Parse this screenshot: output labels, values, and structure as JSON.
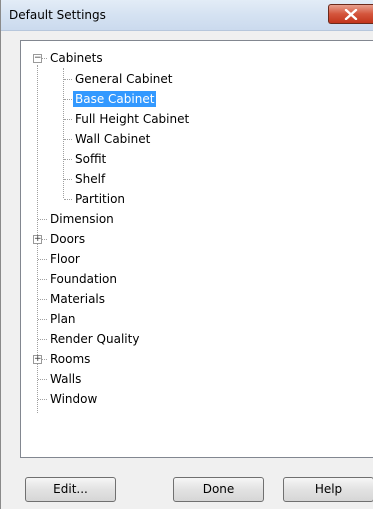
{
  "window": {
    "title": "Default Settings"
  },
  "tree": {
    "cabinets": {
      "label": "Cabinets",
      "expanded": true,
      "children": [
        "General Cabinet",
        "Base Cabinet",
        "Full Height Cabinet",
        "Wall Cabinet",
        "Soffit",
        "Shelf",
        "Partition"
      ],
      "selected": "Base Cabinet"
    },
    "dimension": "Dimension",
    "doors": {
      "label": "Doors",
      "expanded": false
    },
    "floor": "Floor",
    "foundation": "Foundation",
    "materials": "Materials",
    "plan": "Plan",
    "render_quality": "Render Quality",
    "rooms": {
      "label": "Rooms",
      "expanded": false
    },
    "walls": "Walls",
    "window": "Window"
  },
  "buttons": {
    "edit": "Edit...",
    "done": "Done",
    "help": "Help"
  },
  "colors": {
    "selection": "#3399ff",
    "close": "#c2351c"
  }
}
